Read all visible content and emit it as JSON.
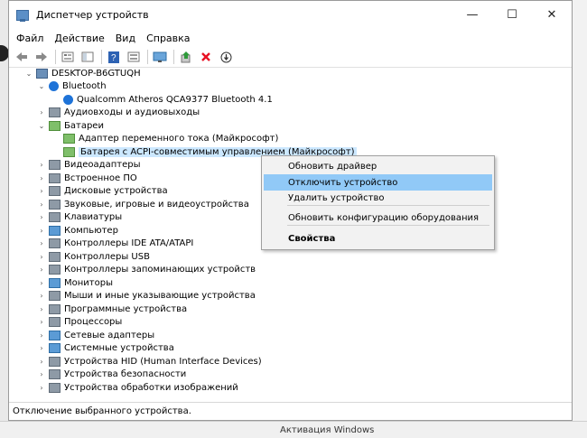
{
  "window": {
    "title": "Диспетчер устройств",
    "controls": {
      "minimize": "—",
      "maximize": "☐",
      "close": "✕"
    }
  },
  "menu": [
    "Файл",
    "Действие",
    "Вид",
    "Справка"
  ],
  "toolbar_icons": [
    "back-arrow-icon",
    "forward-arrow-icon",
    "sep",
    "properties-icon",
    "console-tree-icon",
    "sep",
    "help-icon",
    "show-hidden-icon",
    "sep",
    "monitor-icon",
    "sep",
    "update-driver-icon",
    "uninstall-x-icon",
    "disable-device-icon"
  ],
  "tree": [
    {
      "label": "DESKTOP-B6GTUQH",
      "level": 0,
      "expander": "⌄",
      "icon": "computer"
    },
    {
      "label": "Bluetooth",
      "level": 1,
      "expander": "⌄",
      "icon": "bluetooth"
    },
    {
      "label": "Qualcomm Atheros QCA9377 Bluetooth 4.1",
      "level": 2,
      "expander": "",
      "icon": "bluetooth"
    },
    {
      "label": "Аудиовходы и аудиовыходы",
      "level": 1,
      "expander": "›",
      "icon": "gray"
    },
    {
      "label": "Батареи",
      "level": 1,
      "expander": "⌄",
      "icon": "green"
    },
    {
      "label": "Адаптер переменного тока (Майкрософт)",
      "level": 2,
      "expander": "",
      "icon": "green"
    },
    {
      "label": "Батарея с ACPI-совместимым управлением (Майкрософт)",
      "level": 2,
      "expander": "",
      "icon": "green",
      "selected": true
    },
    {
      "label": "Видеоадаптеры",
      "level": 1,
      "expander": "›",
      "icon": "gray"
    },
    {
      "label": "Встроенное ПО",
      "level": 1,
      "expander": "›",
      "icon": "gray"
    },
    {
      "label": "Дисковые устройства",
      "level": 1,
      "expander": "›",
      "icon": "gray"
    },
    {
      "label": "Звуковые, игровые и видеоустройства",
      "level": 1,
      "expander": "›",
      "icon": "gray"
    },
    {
      "label": "Клавиатуры",
      "level": 1,
      "expander": "›",
      "icon": "gray"
    },
    {
      "label": "Компьютер",
      "level": 1,
      "expander": "›",
      "icon": "blue"
    },
    {
      "label": "Контроллеры IDE ATA/ATAPI",
      "level": 1,
      "expander": "›",
      "icon": "gray"
    },
    {
      "label": "Контроллеры USB",
      "level": 1,
      "expander": "›",
      "icon": "gray"
    },
    {
      "label": "Контроллеры запоминающих устройств",
      "level": 1,
      "expander": "›",
      "icon": "gray"
    },
    {
      "label": "Мониторы",
      "level": 1,
      "expander": "›",
      "icon": "blue"
    },
    {
      "label": "Мыши и иные указывающие устройства",
      "level": 1,
      "expander": "›",
      "icon": "gray"
    },
    {
      "label": "Программные устройства",
      "level": 1,
      "expander": "›",
      "icon": "gray"
    },
    {
      "label": "Процессоры",
      "level": 1,
      "expander": "›",
      "icon": "gray"
    },
    {
      "label": "Сетевые адаптеры",
      "level": 1,
      "expander": "›",
      "icon": "blue"
    },
    {
      "label": "Системные устройства",
      "level": 1,
      "expander": "›",
      "icon": "blue"
    },
    {
      "label": "Устройства HID (Human Interface Devices)",
      "level": 1,
      "expander": "›",
      "icon": "gray"
    },
    {
      "label": "Устройства безопасности",
      "level": 1,
      "expander": "›",
      "icon": "gray"
    },
    {
      "label": "Устройства обработки изображений",
      "level": 1,
      "expander": "›",
      "icon": "gray"
    }
  ],
  "context_menu": [
    {
      "label": "Обновить драйвер"
    },
    {
      "label": "Отключить устройство",
      "highlighted": true
    },
    {
      "label": "Удалить устройство"
    },
    {
      "separator": true
    },
    {
      "label": "Обновить конфигурацию оборудования"
    },
    {
      "separator": true
    },
    {
      "label": "Свойства",
      "bold": true
    }
  ],
  "status": "Отключение выбранного устройства.",
  "background": {
    "activation_text": "Активация Windows"
  },
  "colors": {
    "selection": "#cce8ff",
    "menu_highlight": "#91c9f7",
    "delete_red": "#e81123",
    "update_green": "#2e9a3a"
  }
}
